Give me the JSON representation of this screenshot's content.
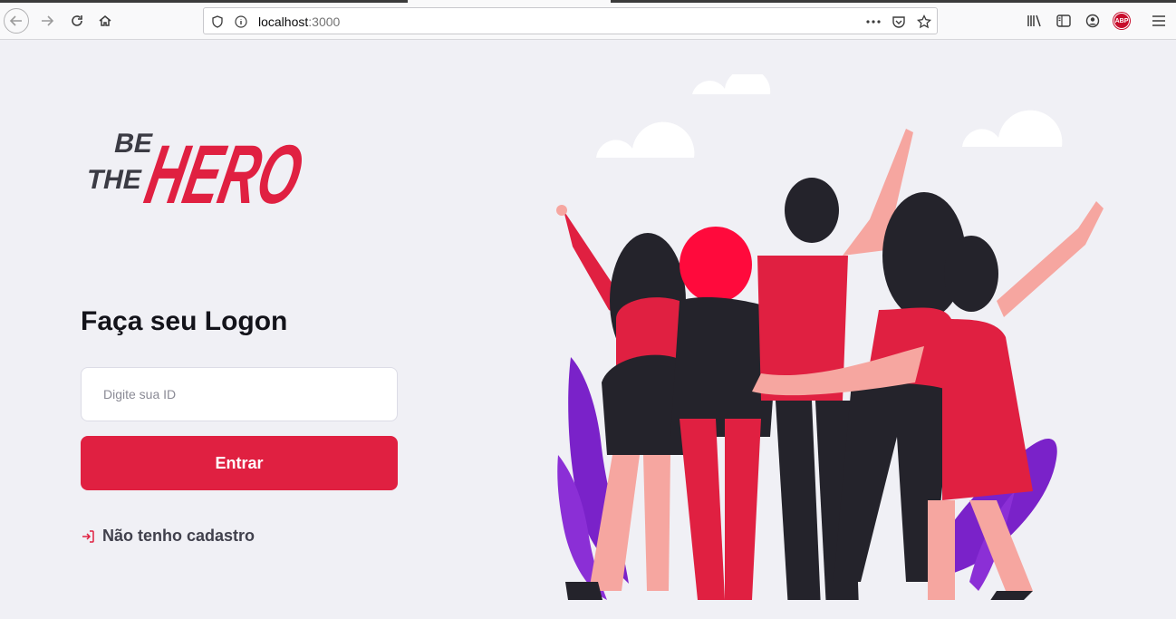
{
  "browser": {
    "url_host": "localhost",
    "url_port": ":3000"
  },
  "logo": {
    "line1": "BE",
    "line2": "THE",
    "brand": "HERO"
  },
  "form": {
    "title": "Faça seu Logon",
    "id_placeholder": "Digite sua ID",
    "submit_label": "Entrar",
    "register_link": "Não tenho cadastro"
  },
  "colors": {
    "accent": "#e02041",
    "background": "#f0f0f5",
    "text": "#13131a"
  }
}
